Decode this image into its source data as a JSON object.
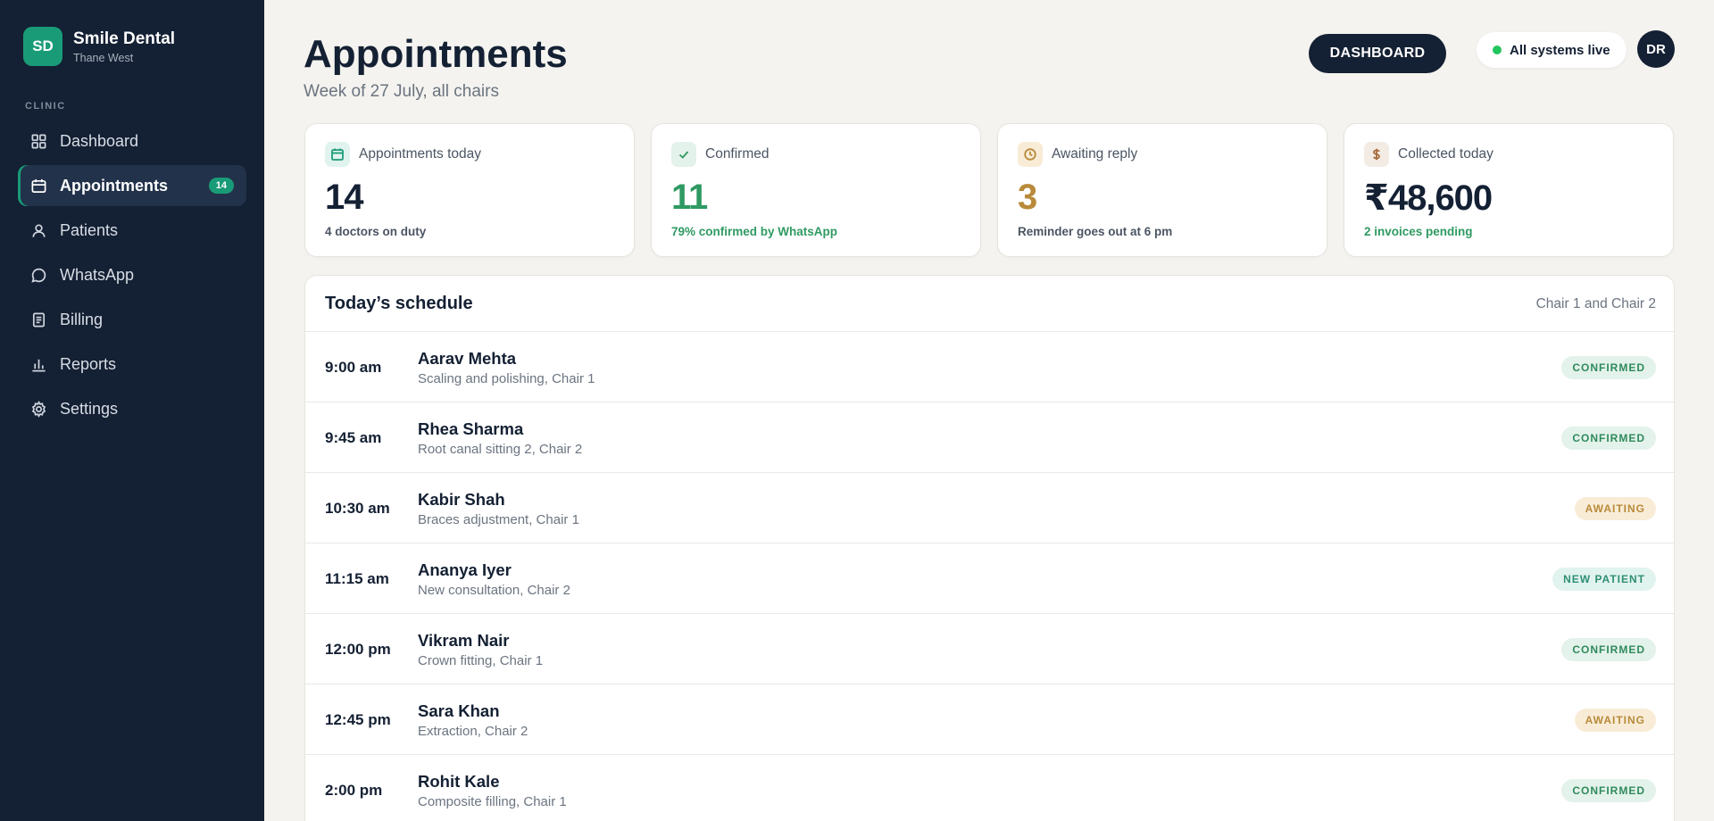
{
  "sidebar": {
    "logo_initials": "SD",
    "brand_name": "Smile Dental",
    "brand_location": "Thane West",
    "section_label": "CLINIC",
    "items": [
      {
        "label": "Dashboard",
        "icon": "grid-icon"
      },
      {
        "label": "Appointments",
        "icon": "calendar-icon",
        "badge": "14",
        "active": true
      },
      {
        "label": "Patients",
        "icon": "user-icon"
      },
      {
        "label": "WhatsApp",
        "icon": "chat-icon"
      },
      {
        "label": "Billing",
        "icon": "receipt-icon"
      },
      {
        "label": "Reports",
        "icon": "bar-chart-icon"
      },
      {
        "label": "Settings",
        "icon": "gear-icon"
      }
    ]
  },
  "header": {
    "title": "Appointments",
    "subtitle": "Week of 27 July, all chairs",
    "dashboard_button": "DASHBOARD",
    "status_text": "All systems live",
    "avatar_initials": "DR"
  },
  "stats": [
    {
      "label": "Appointments today",
      "value": "14",
      "footnote": "4 doctors on duty",
      "icon": "calendar-icon",
      "value_color": "#142033",
      "foot_color": "#4b5563"
    },
    {
      "label": "Confirmed",
      "value": "11",
      "footnote": "79% confirmed by WhatsApp",
      "icon": "check-icon",
      "value_color": "#2f9a62",
      "foot_color": "#2f9a62"
    },
    {
      "label": "Awaiting reply",
      "value": "3",
      "footnote": "Reminder goes out at 6 pm",
      "icon": "clock-icon",
      "value_color": "#b98a3a",
      "foot_color": "#4b5563"
    },
    {
      "label": "Collected today",
      "value": "₹48,600",
      "footnote": "2 invoices pending",
      "icon": "dollar-icon",
      "value_color": "#142033",
      "foot_color": "#2f9a62"
    }
  ],
  "schedule": {
    "title": "Today’s schedule",
    "meta": "Chair 1 and Chair 2",
    "rows": [
      {
        "time": "9:00 am",
        "name": "Aarav Mehta",
        "desc": "Scaling and polishing, Chair 1",
        "status": "CONFIRMED"
      },
      {
        "time": "9:45 am",
        "name": "Rhea Sharma",
        "desc": "Root canal sitting 2, Chair 2",
        "status": "CONFIRMED"
      },
      {
        "time": "10:30 am",
        "name": "Kabir Shah",
        "desc": "Braces adjustment, Chair 1",
        "status": "AWAITING"
      },
      {
        "time": "11:15 am",
        "name": "Ananya Iyer",
        "desc": "New consultation, Chair 2",
        "status": "NEW PATIENT"
      },
      {
        "time": "12:00 pm",
        "name": "Vikram Nair",
        "desc": "Crown fitting, Chair 1",
        "status": "CONFIRMED"
      },
      {
        "time": "12:45 pm",
        "name": "Sara Khan",
        "desc": "Extraction, Chair 2",
        "status": "AWAITING"
      },
      {
        "time": "2:00 pm",
        "name": "Rohit Kale",
        "desc": "Composite filling, Chair 1",
        "status": "CONFIRMED"
      }
    ]
  },
  "colors": {
    "sidebar_bg": "#142033",
    "accent": "#1a9b78",
    "page_bg": "#f4f3ef",
    "confirmed": "#2f8a5c",
    "awaiting": "#b98a3a"
  }
}
